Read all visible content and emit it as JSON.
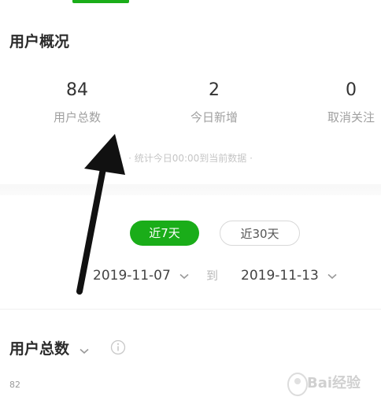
{
  "header": {
    "title": "用户概况"
  },
  "stats": [
    {
      "value": "84",
      "label": "用户总数"
    },
    {
      "value": "2",
      "label": "今日新增"
    },
    {
      "value": "0",
      "label": "取消关注"
    }
  ],
  "note": "· 统计今日00:00到当前数据 ·",
  "range": {
    "seven_days": "近7天",
    "thirty_days": "近30天",
    "selected": "近7天"
  },
  "dates": {
    "start": "2019-11-07",
    "separator": "到",
    "end": "2019-11-13"
  },
  "chart": {
    "title": "用户总数",
    "y_tick": "82"
  },
  "watermark": {
    "text": "Bai经验"
  },
  "colors": {
    "accent": "#1aad19",
    "muted": "#a0a0a0"
  },
  "icons": {
    "dropdown": "chevron-down-icon",
    "info": "info-icon",
    "annotation": "arrow-up-icon"
  }
}
